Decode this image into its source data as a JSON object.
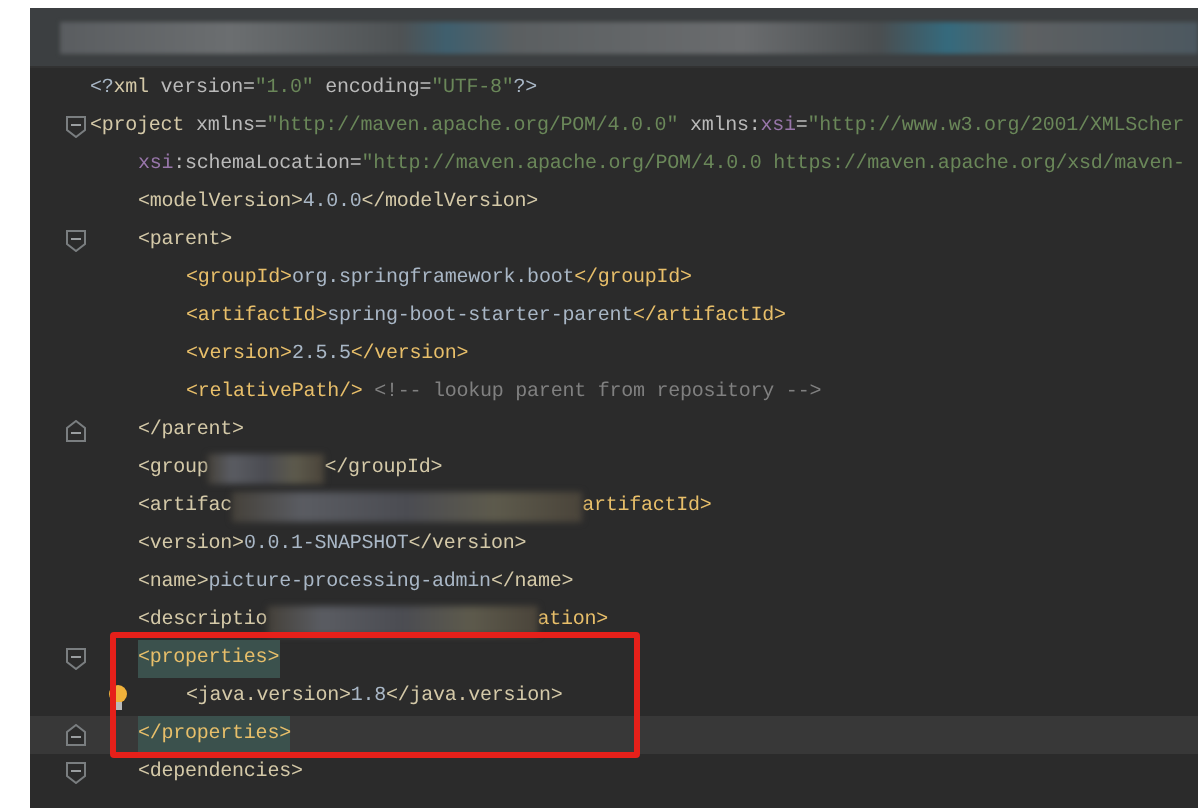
{
  "editor": {
    "lines": [
      {
        "fold_open": false,
        "fold_close": false,
        "bulb": false,
        "current": false,
        "segments": [
          {
            "kind": "punct",
            "text": "<?"
          },
          {
            "kind": "tag-dim",
            "text": "xml"
          },
          {
            "kind": "attr",
            "text": " version="
          },
          {
            "kind": "string",
            "text": "\"1.0\""
          },
          {
            "kind": "attr",
            "text": " encoding="
          },
          {
            "kind": "string",
            "text": "\"UTF-8\""
          },
          {
            "kind": "punct",
            "text": "?>"
          }
        ]
      },
      {
        "fold_open": true,
        "fold_close": false,
        "bulb": false,
        "current": false,
        "segments": [
          {
            "kind": "tag-dim",
            "text": "<project"
          },
          {
            "kind": "attr",
            "text": " xmlns="
          },
          {
            "kind": "string",
            "text": "\"http://maven.apache.org/POM/4.0.0\""
          },
          {
            "kind": "attr",
            "text": " xmlns:"
          },
          {
            "kind": "ns",
            "text": "xsi"
          },
          {
            "kind": "attr",
            "text": "="
          },
          {
            "kind": "string",
            "text": "\"http://www.w3.org/2001/XMLScher"
          }
        ],
        "children": [
          {
            "fold_open": false,
            "fold_close": false,
            "bulb": false,
            "current": false,
            "segments": [
              {
                "kind": "ns",
                "text": "xsi"
              },
              {
                "kind": "attr",
                "text": ":schemaLocation="
              },
              {
                "kind": "string",
                "text": "\"http://maven.apache.org/POM/4.0.0 https://maven.apache.org/xsd/maven-"
              }
            ]
          },
          {
            "fold_open": false,
            "fold_close": false,
            "bulb": false,
            "current": false,
            "segments": [
              {
                "kind": "tag-dim",
                "text": "<modelVersion>"
              },
              {
                "kind": "text",
                "text": "4.0.0"
              },
              {
                "kind": "tag-dim",
                "text": "</modelVersion>"
              }
            ]
          },
          {
            "fold_open": true,
            "fold_close": false,
            "bulb": false,
            "current": false,
            "segments": [
              {
                "kind": "tag-dim",
                "text": "<parent>"
              }
            ],
            "children": [
              {
                "fold_open": false,
                "fold_close": false,
                "bulb": false,
                "current": false,
                "segments": [
                  {
                    "kind": "tag",
                    "text": "<groupId>"
                  },
                  {
                    "kind": "text",
                    "text": "org.springframework.boot"
                  },
                  {
                    "kind": "tag",
                    "text": "</groupId>"
                  }
                ]
              },
              {
                "fold_open": false,
                "fold_close": false,
                "bulb": false,
                "current": false,
                "segments": [
                  {
                    "kind": "tag",
                    "text": "<artifactId>"
                  },
                  {
                    "kind": "text",
                    "text": "spring-boot-starter-parent"
                  },
                  {
                    "kind": "tag",
                    "text": "</artifactId>"
                  }
                ]
              },
              {
                "fold_open": false,
                "fold_close": false,
                "bulb": false,
                "current": false,
                "segments": [
                  {
                    "kind": "tag",
                    "text": "<version>"
                  },
                  {
                    "kind": "text",
                    "text": "2.5.5"
                  },
                  {
                    "kind": "tag",
                    "text": "</version>"
                  }
                ]
              },
              {
                "fold_open": false,
                "fold_close": false,
                "bulb": false,
                "current": false,
                "segments": [
                  {
                    "kind": "tag",
                    "text": "<relativePath/>"
                  },
                  {
                    "kind": "comment",
                    "text": " <!-- lookup parent from repository -->"
                  }
                ]
              }
            ]
          },
          {
            "fold_open": false,
            "fold_close": true,
            "bulb": false,
            "current": false,
            "segments": [
              {
                "kind": "tag-dim",
                "text": "</parent>"
              }
            ]
          },
          {
            "fold_open": false,
            "fold_close": false,
            "bulb": false,
            "current": false,
            "segments": [
              {
                "kind": "tag-dim",
                "text": "<group"
              },
              {
                "kind": "blur-short"
              },
              {
                "kind": "tag-dim",
                "text": "</groupId>"
              }
            ]
          },
          {
            "fold_open": false,
            "fold_close": false,
            "bulb": false,
            "current": false,
            "segments": [
              {
                "kind": "tag-dim",
                "text": "<artifac"
              },
              {
                "kind": "blur-long"
              },
              {
                "kind": "tag",
                "text": "artifactId>"
              }
            ]
          },
          {
            "fold_open": false,
            "fold_close": false,
            "bulb": false,
            "current": false,
            "segments": [
              {
                "kind": "tag-dim",
                "text": "<version>"
              },
              {
                "kind": "text",
                "text": "0.0.1-SNAPSHOT"
              },
              {
                "kind": "tag-dim",
                "text": "</version>"
              }
            ]
          },
          {
            "fold_open": false,
            "fold_close": false,
            "bulb": false,
            "current": false,
            "segments": [
              {
                "kind": "tag-dim",
                "text": "<name>"
              },
              {
                "kind": "text",
                "text": "picture-processing-admin"
              },
              {
                "kind": "tag-dim",
                "text": "</name>"
              }
            ]
          },
          {
            "fold_open": false,
            "fold_close": false,
            "bulb": false,
            "current": false,
            "segments": [
              {
                "kind": "tag-dim",
                "text": "<descriptio"
              },
              {
                "kind": "blur-medium"
              },
              {
                "kind": "tag",
                "text": "ation>"
              }
            ]
          },
          {
            "fold_open": true,
            "fold_close": false,
            "bulb": false,
            "current": false,
            "segments": [
              {
                "kind": "tag-match",
                "text": "<properties>"
              }
            ],
            "children": [
              {
                "fold_open": false,
                "fold_close": false,
                "bulb": true,
                "current": false,
                "segments": [
                  {
                    "kind": "tag-dim",
                    "text": "<java.version>"
                  },
                  {
                    "kind": "text",
                    "text": "1.8"
                  },
                  {
                    "kind": "tag-dim",
                    "text": "</java.version>"
                  }
                ]
              }
            ]
          },
          {
            "fold_open": false,
            "fold_close": true,
            "bulb": false,
            "current": true,
            "segments": [
              {
                "kind": "tag-match",
                "text": "</properties>"
              }
            ]
          },
          {
            "fold_open": true,
            "fold_close": false,
            "bulb": false,
            "current": false,
            "segments": [
              {
                "kind": "tag-dim",
                "text": "<dependencies>"
              }
            ]
          }
        ]
      }
    ]
  }
}
